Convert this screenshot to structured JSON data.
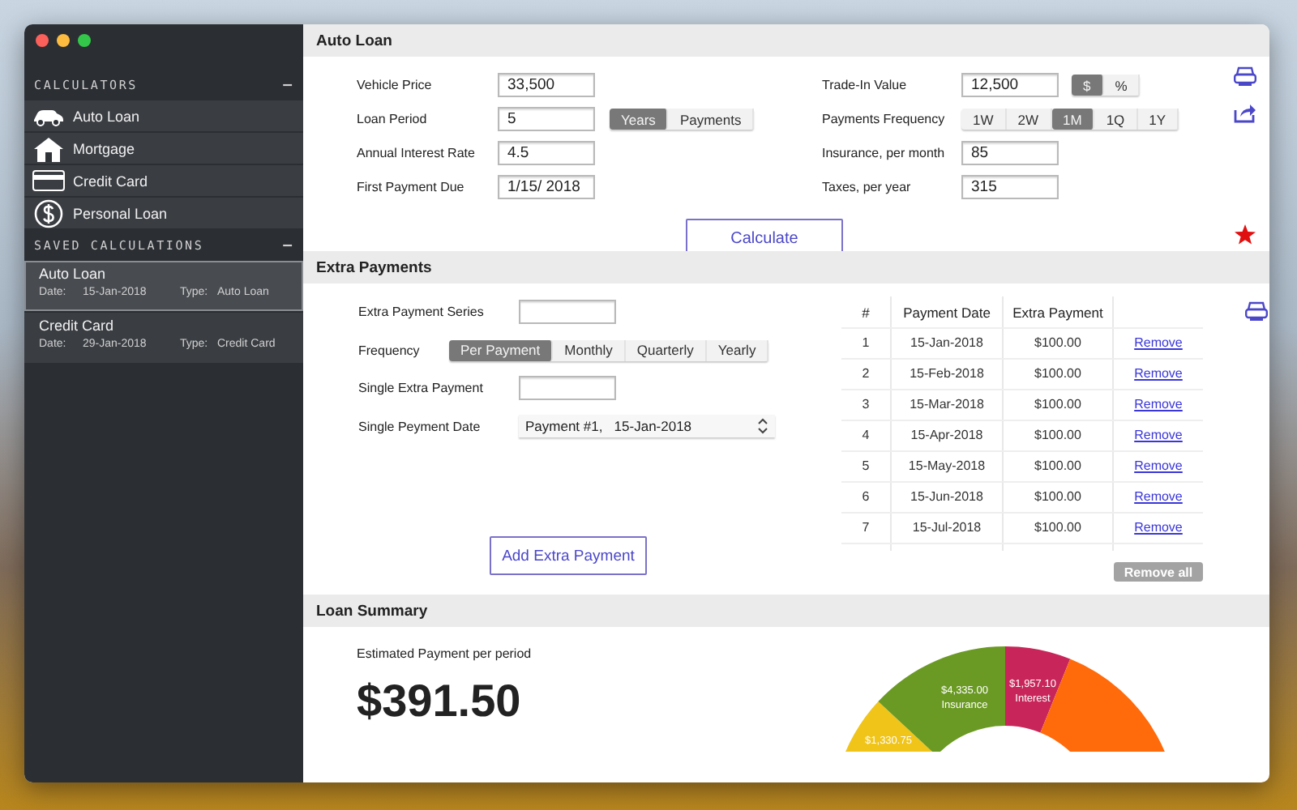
{
  "sidebar": {
    "sections": [
      {
        "title": "CALCULATORS",
        "toggle": "–",
        "kind": "calculators",
        "items": [
          {
            "label": "Auto Loan",
            "selected": false
          },
          {
            "label": "Mortgage",
            "selected": false
          },
          {
            "label": "Credit Card",
            "selected": false
          },
          {
            "label": "Personal Loan",
            "selected": false
          }
        ]
      },
      {
        "title": "SAVED CALCULATIONS",
        "toggle": "–",
        "kind": "saved",
        "items": [
          {
            "title": "Auto Loan",
            "date_label": "Date:",
            "date": "15-Jan-2018",
            "type_label": "Type:",
            "type": "Auto Loan",
            "selected": true
          },
          {
            "title": "Credit Card",
            "date_label": "Date:",
            "date": "29-Jan-2018",
            "type_label": "Type:",
            "type": "Credit Card",
            "selected": false
          }
        ]
      }
    ]
  },
  "auto_loan": {
    "title": "Auto Loan",
    "left_fields": [
      {
        "kind": "input",
        "label": "Vehicle Price",
        "value": "33,500"
      },
      {
        "kind": "input_segmented",
        "label": "Loan Period",
        "value": "5",
        "options": [
          {
            "label": "Years",
            "selected": true
          },
          {
            "label": "Payments",
            "selected": false
          }
        ]
      },
      {
        "kind": "input",
        "label": "Annual Interest Rate",
        "value": "4.5"
      },
      {
        "kind": "input",
        "label": "First Payment Due",
        "value": "1/15/ 2018"
      }
    ],
    "right_fields": [
      {
        "kind": "input_segmented",
        "label": "Trade-In Value",
        "value": "12,500",
        "options": [
          {
            "label": "$",
            "selected": true
          },
          {
            "label": "%",
            "selected": false
          }
        ]
      },
      {
        "kind": "segmented",
        "label": "Payments Frequency",
        "options": [
          {
            "label": "1W",
            "selected": false
          },
          {
            "label": "2W",
            "selected": false
          },
          {
            "label": "1M",
            "selected": true
          },
          {
            "label": "1Q",
            "selected": false
          },
          {
            "label": "1Y",
            "selected": false
          }
        ]
      },
      {
        "kind": "input",
        "label": "Insurance, per month",
        "value": "85"
      },
      {
        "kind": "input",
        "label": "Taxes, per year",
        "value": "315"
      }
    ],
    "calculate_button": "Calculate"
  },
  "extra_payments": {
    "title": "Extra Payments",
    "fields": [
      {
        "kind": "input",
        "label": "Extra Payment Series"
      },
      {
        "kind": "segmented",
        "label": "Frequency",
        "options": [
          {
            "label": "Per Payment",
            "selected": true
          },
          {
            "label": "Monthly",
            "selected": false
          },
          {
            "label": "Quarterly",
            "selected": false
          },
          {
            "label": "Yearly",
            "selected": false
          }
        ]
      },
      {
        "kind": "input",
        "label": "Single Extra Payment"
      },
      {
        "kind": "select",
        "label": "Single Peyment Date",
        "value": "Payment #1,   15-Jan-2018"
      }
    ],
    "add_button": "Add Extra Payment",
    "table": {
      "columns": [
        "#",
        "Payment  Date",
        "Extra Payment"
      ],
      "rows": [
        {
          "number": "1",
          "date": "15-Jan-2018",
          "amount": "$100.00",
          "action": "Remove"
        },
        {
          "number": "2",
          "date": "15-Feb-2018",
          "amount": "$100.00",
          "action": "Remove"
        },
        {
          "number": "3",
          "date": "15-Mar-2018",
          "amount": "$100.00",
          "action": "Remove"
        },
        {
          "number": "4",
          "date": "15-Apr-2018",
          "amount": "$100.00",
          "action": "Remove"
        },
        {
          "number": "5",
          "date": "15-May-2018",
          "amount": "$100.00",
          "action": "Remove"
        },
        {
          "number": "6",
          "date": "15-Jun-2018",
          "amount": "$100.00",
          "action": "Remove"
        },
        {
          "number": "7",
          "date": "15-Jul-2018",
          "amount": "$100.00",
          "action": "Remove"
        }
      ]
    },
    "remove_all_button": "Remove all"
  },
  "loan_summary": {
    "title": "Loan Summary",
    "estimate_label": "Estimated Payment per period",
    "estimate": "$391.50",
    "segments": [
      {
        "color": "#f0c419",
        "value": "$1,330.75"
      },
      {
        "color": "#6a9a23",
        "value": "$4,335.00",
        "label": "Insurance"
      },
      {
        "color": "#c8265a",
        "value": "$1,957.10",
        "label": "Interest"
      },
      {
        "color": "#ff6a0a"
      }
    ]
  }
}
